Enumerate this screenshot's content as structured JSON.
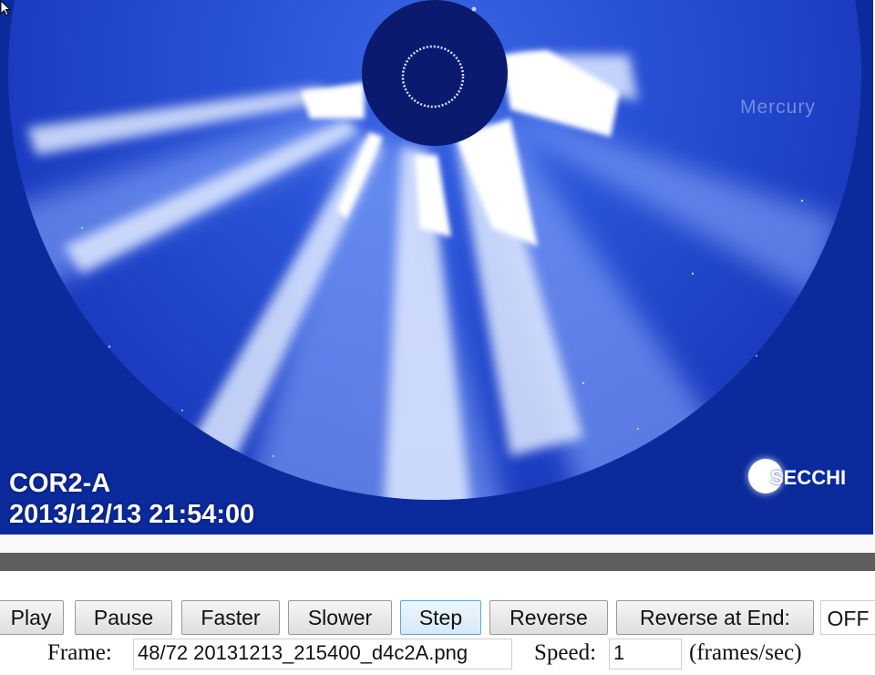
{
  "viewer": {
    "instrument": "COR2-A",
    "timestamp": "2013/12/13 21:54:00",
    "planet_label": "Mercury",
    "logo_text": "SECCHI",
    "colors": {
      "background": "#0b2b9c",
      "corona": "#ffffff",
      "occulter": "#0a1a6e",
      "planet_label": "#6f8ee0"
    }
  },
  "controls": {
    "play": "Play",
    "pause": "Pause",
    "faster": "Faster",
    "slower": "Slower",
    "step": "Step",
    "reverse": "Reverse",
    "reverse_at_end": "Reverse at End:",
    "reverse_at_end_state": "OFF"
  },
  "frame_info": {
    "frame_label": "Frame:",
    "frame_value": "48/72 20131213_215400_d4c2A.png",
    "speed_label": "Speed:",
    "speed_value": "1",
    "speed_unit": "(frames/sec)"
  }
}
